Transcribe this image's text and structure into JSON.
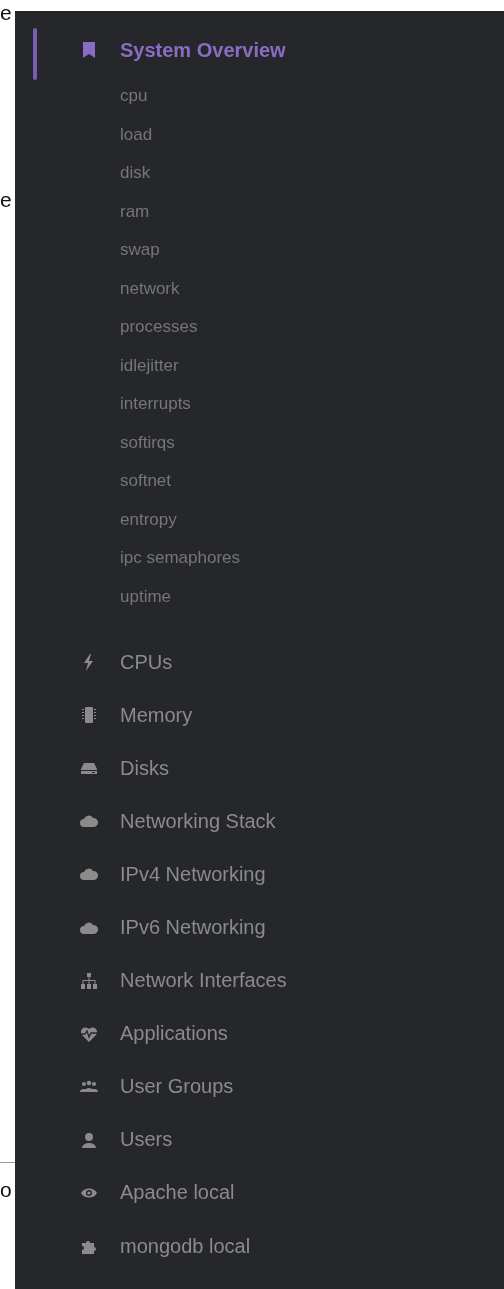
{
  "edge_texts": [
    "e",
    "e",
    "o"
  ],
  "sidebar": {
    "items": [
      {
        "label": "System Overview",
        "selected": true,
        "children": [
          "cpu",
          "load",
          "disk",
          "ram",
          "swap",
          "network",
          "processes",
          "idlejitter",
          "interrupts",
          "softirqs",
          "softnet",
          "entropy",
          "ipc semaphores",
          "uptime"
        ]
      },
      {
        "label": "CPUs",
        "selected": false
      },
      {
        "label": "Memory",
        "selected": false
      },
      {
        "label": "Disks",
        "selected": false
      },
      {
        "label": "Networking Stack",
        "selected": false
      },
      {
        "label": "IPv4 Networking",
        "selected": false
      },
      {
        "label": "IPv6 Networking",
        "selected": false
      },
      {
        "label": "Network Interfaces",
        "selected": false
      },
      {
        "label": "Applications",
        "selected": false
      },
      {
        "label": "User Groups",
        "selected": false
      },
      {
        "label": "Users",
        "selected": false
      },
      {
        "label": "Apache local",
        "selected": false
      },
      {
        "label": "mongodb local",
        "selected": false
      }
    ]
  }
}
